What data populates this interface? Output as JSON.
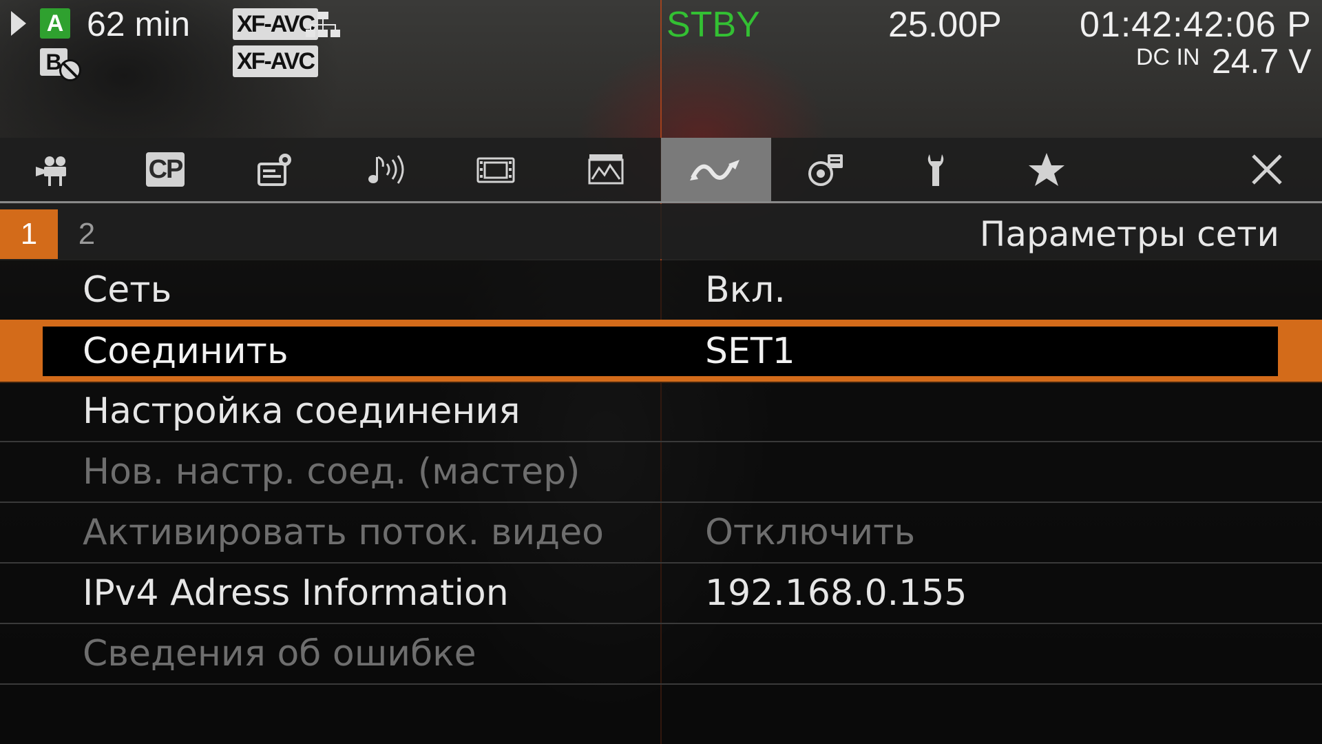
{
  "status": {
    "slot_a_letter": "A",
    "remaining_time": "62 min",
    "slot_b_letter": "B",
    "format_a": "XF-AVC",
    "format_b": "XF-AVC",
    "record_state": "STBY",
    "frame_rate": "25.00P",
    "timecode": "01:42:42:06 P",
    "power_source": "DC IN",
    "voltage": "24.7 V"
  },
  "tabs": [
    {
      "name": "camera-setup",
      "icon": "movie-camera-icon"
    },
    {
      "name": "custom-picture",
      "icon": "cp-icon",
      "label": "CP"
    },
    {
      "name": "recording-media",
      "icon": "recording-setup-icon"
    },
    {
      "name": "audio",
      "icon": "audio-icon"
    },
    {
      "name": "monitoring",
      "icon": "film-frame-icon"
    },
    {
      "name": "assistance",
      "icon": "waveform-icon"
    },
    {
      "name": "network",
      "icon": "network-wave-icon",
      "active": true
    },
    {
      "name": "other-functions",
      "icon": "recording-reel-icon"
    },
    {
      "name": "system-setup",
      "icon": "wrench-icon"
    },
    {
      "name": "my-menu",
      "icon": "star-icon"
    },
    {
      "name": "close",
      "icon": "close-icon"
    }
  ],
  "pages": {
    "current": "1",
    "next": "2"
  },
  "menu": {
    "title": "Параметры сети",
    "items": [
      {
        "label": "Сеть",
        "value": "Вкл.",
        "state": "enabled"
      },
      {
        "label": "Соединить",
        "value": "SET1",
        "state": "selected"
      },
      {
        "label": "Настройка соединения",
        "value": "",
        "state": "enabled"
      },
      {
        "label": "Нов. настр. соед. (мастер)",
        "value": "",
        "state": "disabled"
      },
      {
        "label": "Активировать поток. видео",
        "value": "Отключить",
        "state": "disabled"
      },
      {
        "label": "IPv4 Adress Information",
        "value": "192.168.0.155",
        "state": "enabled"
      },
      {
        "label": "Сведения об ошибке",
        "value": "",
        "state": "disabled"
      }
    ]
  },
  "colors": {
    "accent": "#d36b1a",
    "standby_green": "#33c033",
    "slot_a_green": "#2fa12f"
  }
}
